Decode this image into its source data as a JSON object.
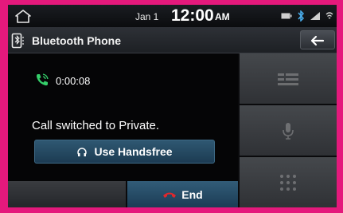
{
  "status_bar": {
    "date": "Jan 1",
    "time": "12:00",
    "ampm": "AM"
  },
  "title_bar": {
    "title": "Bluetooth Phone"
  },
  "call": {
    "duration": "0:00:08",
    "status_message": "Call switched to Private.",
    "handsfree_label": "Use Handsfree",
    "end_label": "End"
  },
  "side_buttons": [
    {
      "icon": "keypad-icon"
    },
    {
      "icon": "microphone-icon"
    },
    {
      "icon": "dialpad-icon"
    }
  ],
  "colors": {
    "frame": "#e4197c",
    "call_green": "#35d06a",
    "end_red": "#e0272c",
    "button_blue": "#2a5170"
  }
}
